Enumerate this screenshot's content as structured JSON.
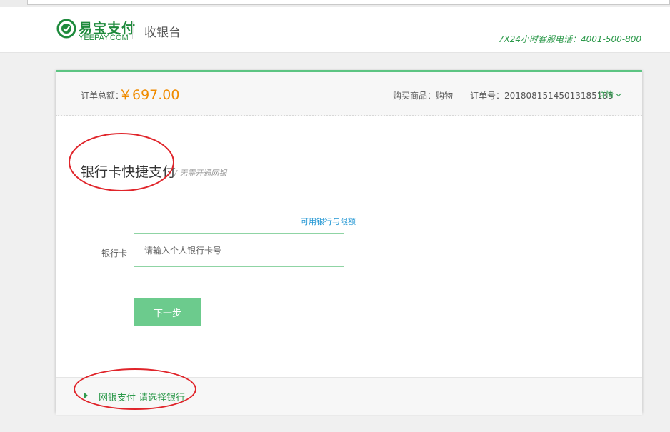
{
  "brand": {
    "name_cn": "易宝支付",
    "name_en": "YEEPAY.COM",
    "page_title": "收银台",
    "hotline": "7X24小时客服电话：4001-500-800",
    "color": "#1e8a3c"
  },
  "order": {
    "amount_label": "订单总额：",
    "amount_value": "￥697.00",
    "goods": "购买商品：购物",
    "order_no": "订单号：20180815145013185135",
    "detail_label": "详情"
  },
  "quick_pay": {
    "title": "银行卡快捷支付",
    "subtitle": "/ 无需开通网银",
    "limits_link": "可用银行与限额",
    "card_label": "银行卡",
    "card_placeholder": "请输入个人银行卡号",
    "card_value": "",
    "next_button": "下一步"
  },
  "netbank": {
    "label": "网银支付 请选择银行"
  },
  "annotation_color": "#e0242a"
}
